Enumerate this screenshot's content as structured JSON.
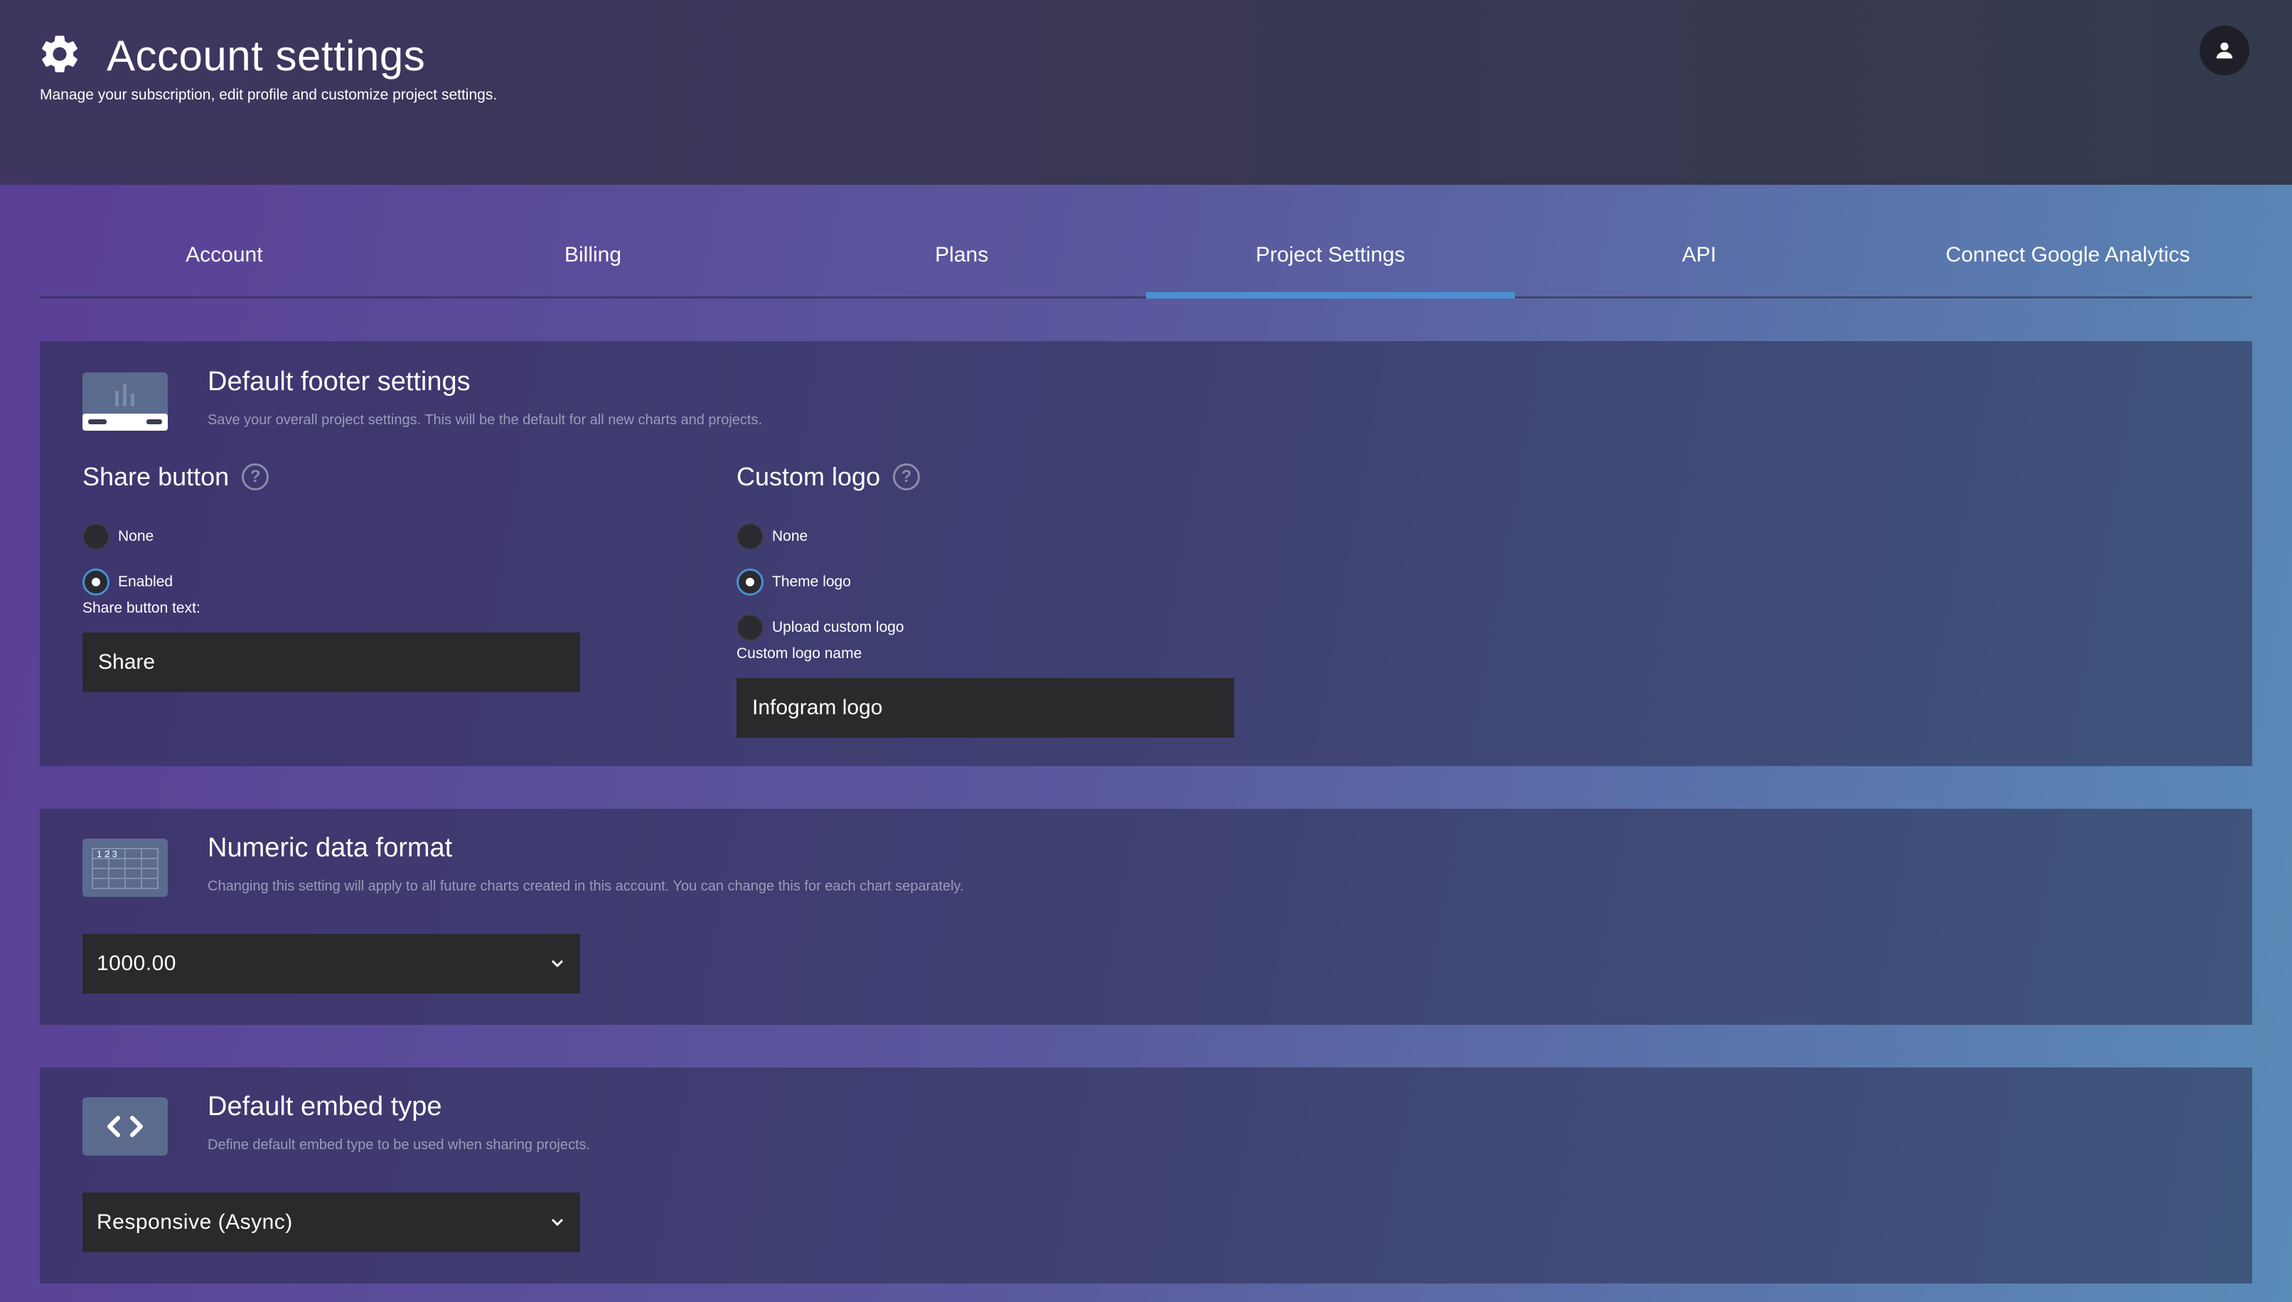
{
  "header": {
    "title": "Account settings",
    "subtitle": "Manage your subscription, edit profile and customize project settings."
  },
  "tabs": [
    {
      "label": "Account",
      "active": false
    },
    {
      "label": "Billing",
      "active": false
    },
    {
      "label": "Plans",
      "active": false
    },
    {
      "label": "Project Settings",
      "active": true
    },
    {
      "label": "API",
      "active": false
    },
    {
      "label": "Connect Google Analytics",
      "active": false
    }
  ],
  "footer_settings": {
    "title": "Default footer settings",
    "description": "Save your overall project settings. This will be the default for all new charts and projects.",
    "share_button": {
      "heading": "Share button",
      "options": [
        {
          "label": "None",
          "checked": false
        },
        {
          "label": "Enabled",
          "checked": true
        }
      ],
      "text_label": "Share button text:",
      "text_value": "Share"
    },
    "custom_logo": {
      "heading": "Custom logo",
      "options": [
        {
          "label": "None",
          "checked": false
        },
        {
          "label": "Theme logo",
          "checked": true
        },
        {
          "label": "Upload custom logo",
          "checked": false
        }
      ],
      "name_label": "Custom logo name",
      "name_value": "Infogram logo"
    }
  },
  "numeric_format": {
    "title": "Numeric data format",
    "description": "Changing this setting will apply to all future charts created in this account. You can change this for each chart separately.",
    "icon_text": "1 2 3",
    "selected": "1000.00"
  },
  "embed_type": {
    "title": "Default embed type",
    "description": "Define default embed type to be used when sharing projects.",
    "selected": "Responsive (Async)"
  },
  "colors": {
    "accent": "#4a90d2",
    "input_bg": "#2a2a2d",
    "card_icon_bg": "#5b6b8e"
  },
  "icons": {
    "header": "gear-icon",
    "avatar": "user-icon",
    "help": "help-icon",
    "footer_card": "footer-preview-icon",
    "numeric_card": "number-grid-icon",
    "embed_card": "code-icon",
    "select": "chevron-down-icon"
  }
}
